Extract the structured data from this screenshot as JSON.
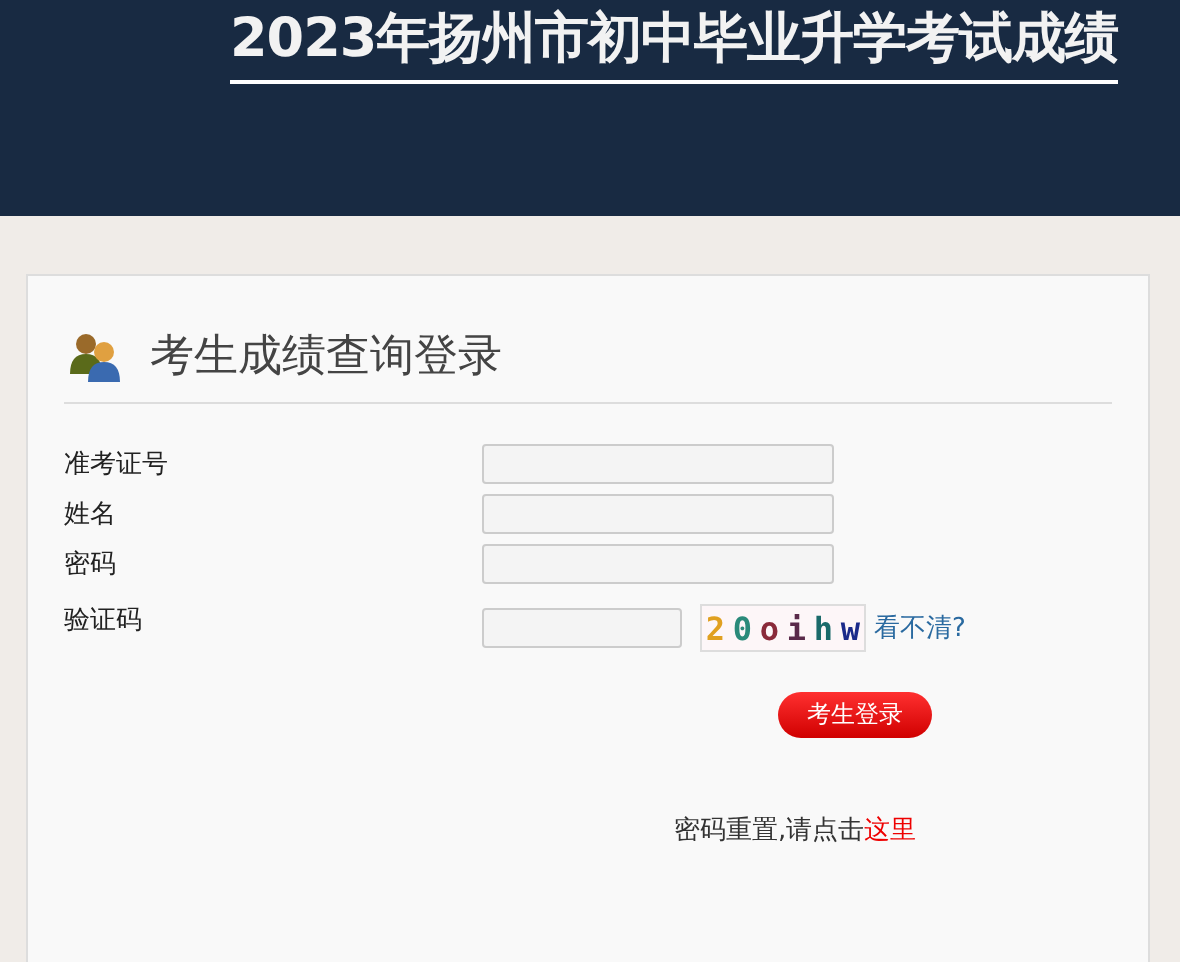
{
  "header": {
    "title": "2023年扬州市初中毕业升学考试成绩"
  },
  "panel": {
    "heading": "考生成绩查询登录"
  },
  "fields": [
    {
      "label": "准考证号"
    },
    {
      "label": "姓名"
    },
    {
      "label": "密码"
    }
  ],
  "captcha": {
    "label": "验证码",
    "chars": [
      {
        "char": "2",
        "color": "#e0a020"
      },
      {
        "char": "0",
        "color": "#2a8a7a"
      },
      {
        "char": "o",
        "color": "#8a2a3a"
      },
      {
        "char": "i",
        "color": "#5a2a4a"
      },
      {
        "char": "h",
        "color": "#1a6a6a"
      },
      {
        "char": "w",
        "color": "#1a2a8a"
      }
    ],
    "refresh_link": "看不清?"
  },
  "login_button": "考生登录",
  "reset": {
    "text": "密码重置,请点击",
    "link": "这里"
  }
}
